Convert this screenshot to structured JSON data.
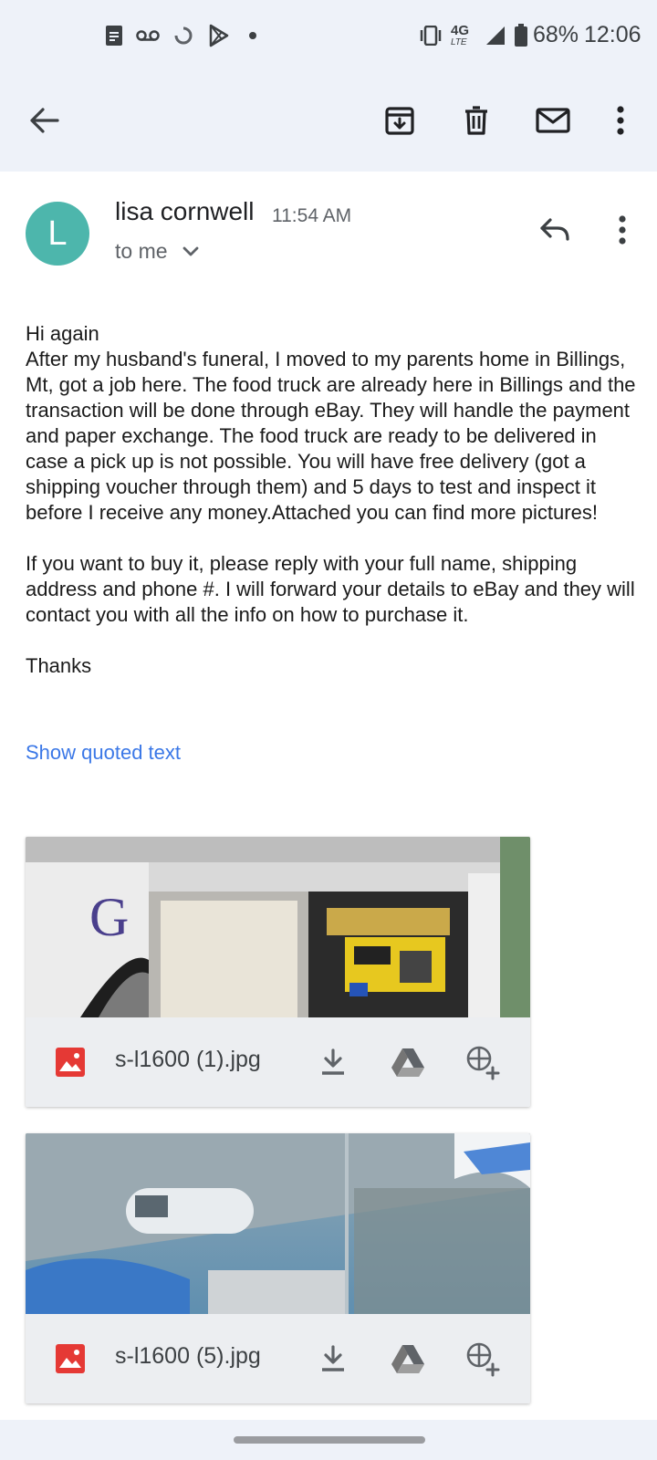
{
  "status_bar": {
    "battery": "68%",
    "time": "12:06",
    "network": "4G",
    "network_sub": "LTE",
    "icons": [
      "note-icon",
      "voicemail-icon",
      "sync-icon",
      "play-store-icon",
      "dot-icon",
      "vibrate-icon",
      "signal-icon",
      "battery-icon"
    ]
  },
  "toolbar": {
    "icons": [
      "back-arrow-icon",
      "archive-icon",
      "delete-icon",
      "mark-unread-icon",
      "more-vert-icon"
    ]
  },
  "message": {
    "avatar_letter": "L",
    "sender": "lisa cornwell",
    "time": "11:54 AM",
    "recipient_label": "to me",
    "paragraphs": {
      "greeting": "Hi again",
      "p1": "After my husband's funeral, I moved to my parents home in Billings, Mt, got a job here. The food truck are already here in Billings and the transaction will be done through eBay. They will handle the payment and paper exchange. The food truck are ready to be delivered in case a pick up is not possible. You will have free delivery (got a shipping voucher through them) and 5 days to test and inspect it before I receive any money.Attached you can find more pictures!",
      "p2": "If you want to buy it, please reply with your full name, shipping address and phone #. I will forward your details to eBay and they will contact you with all the info on how to purchase it.",
      "signoff": "Thanks"
    },
    "show_quoted": "Show quoted text"
  },
  "attachments": [
    {
      "name": "s-l1600 (1).jpg",
      "type_icon": "image-file-icon"
    },
    {
      "name": "s-l1600 (5).jpg",
      "type_icon": "image-file-icon"
    }
  ],
  "colors": {
    "avatar": "#4db6ac",
    "link": "#3b78e7",
    "header_bg": "#eef2f9",
    "image_icon": "#e53935"
  }
}
